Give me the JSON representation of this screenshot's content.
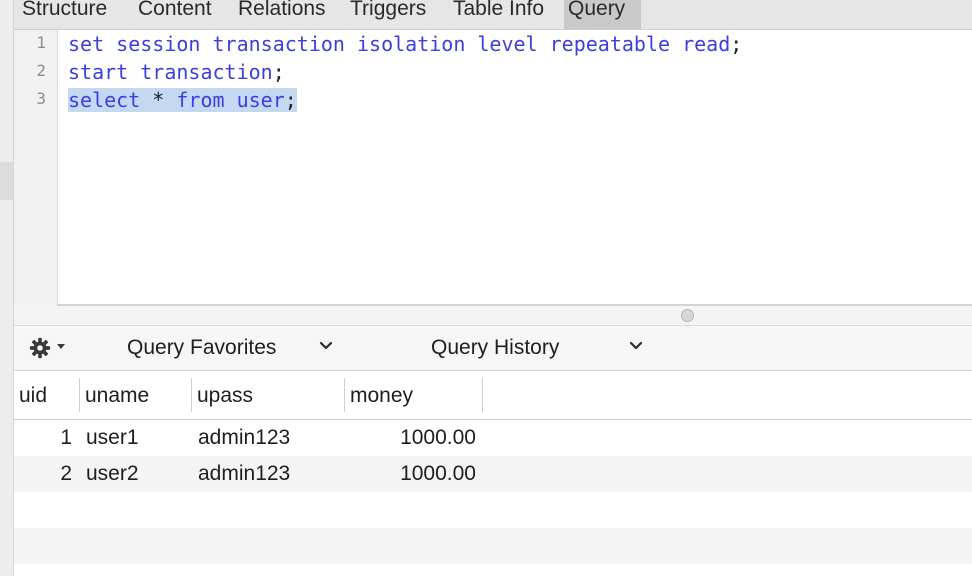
{
  "tabs": [
    {
      "label": "Structure",
      "active": false
    },
    {
      "label": "Content",
      "active": false
    },
    {
      "label": "Relations",
      "active": false
    },
    {
      "label": "Triggers",
      "active": false
    },
    {
      "label": "Table Info",
      "active": false
    },
    {
      "label": "Query",
      "active": true
    }
  ],
  "editor": {
    "line_numbers": [
      "1",
      "2",
      "3"
    ],
    "lines": [
      {
        "keywords": "set session transaction isolation level repeatable read",
        "punct": ";"
      },
      {
        "keywords": "start transaction",
        "punct": ";"
      },
      {
        "keywords": "select",
        "star": " * ",
        "kw2": "from user",
        "punct": ";"
      }
    ]
  },
  "toolbar": {
    "favorites_label": "Query Favorites",
    "history_label": "Query History"
  },
  "results": {
    "columns": [
      "uid",
      "uname",
      "upass",
      "money"
    ],
    "rows": [
      [
        "1",
        "user1",
        "admin123",
        "1000.00"
      ],
      [
        "2",
        "user2",
        "admin123",
        "1000.00"
      ]
    ]
  },
  "colors": {
    "keyword": "#3b3ee0",
    "selection": "#c4d8f2",
    "active_tab": "#c9c9c9"
  },
  "icons": [
    "gear-icon",
    "caret-down-icon",
    "chevron-down-icon"
  ]
}
